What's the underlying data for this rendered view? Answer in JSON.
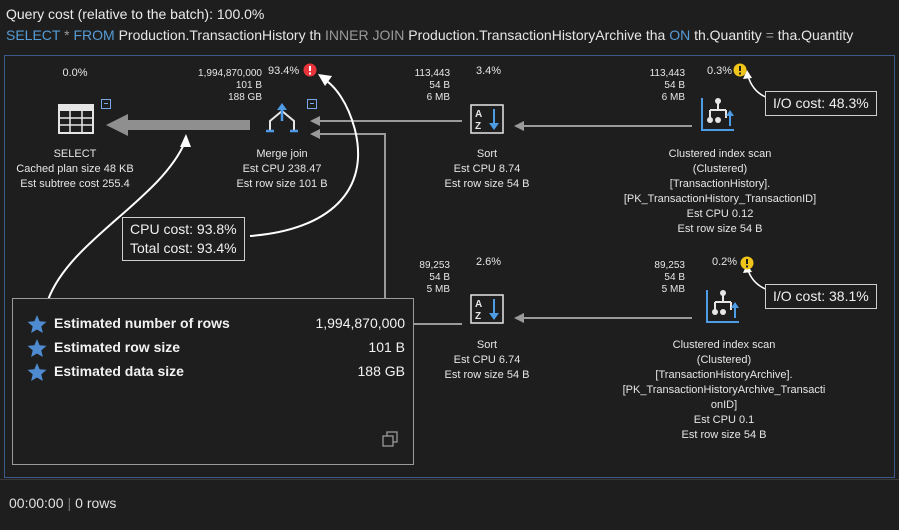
{
  "header": {
    "query_cost": "Query cost (relative to the batch):  100.0%",
    "sql": {
      "select": "SELECT",
      "star": "*",
      "from": "FROM",
      "table1": "Production.TransactionHistory th",
      "join": "INNER JOIN",
      "table2": "Production.TransactionHistoryArchive tha",
      "on": "ON",
      "left_col": "th.Quantity",
      "eq": "=",
      "right_col": "tha.Quantity"
    }
  },
  "nodes": {
    "select": {
      "cost": "0.0%",
      "name": "SELECT",
      "line1": "Cached plan size  48 KB",
      "line2": "Est subtree cost  255.4",
      "icon": "select-grid-icon"
    },
    "merge_join": {
      "rows": "1,994,870,000",
      "row_size": "101 B",
      "data_size": "188 GB",
      "cost": "93.4%",
      "name": "Merge join",
      "line1": "Est CPU  238.47",
      "line2": "Est row size  101 B",
      "icon": "merge-join-icon",
      "warning_icon": "error-icon"
    },
    "sort_top": {
      "rows": "113,443",
      "row_size": "54 B",
      "data_size": "6 MB",
      "cost": "3.4%",
      "name": "Sort",
      "line1": "Est CPU  8.74",
      "line2": "Est row size  54 B",
      "icon": "sort-az-icon"
    },
    "scan_top": {
      "rows": "113,443",
      "row_size": "54 B",
      "data_size": "6 MB",
      "cost": "0.3%",
      "name": "Clustered index scan",
      "line1": "(Clustered)",
      "line2": "[TransactionHistory].",
      "line3": "[PK_TransactionHistory_TransactionID]",
      "line4": "Est CPU  0.12",
      "line5": "Est row size  54 B",
      "icon": "clustered-index-scan-icon",
      "warning_icon": "warning-icon"
    },
    "sort_bottom": {
      "rows": "89,253",
      "row_size": "54 B",
      "data_size": "5 MB",
      "cost": "2.6%",
      "name": "Sort",
      "line1": "Est CPU  6.74",
      "line2": "Est row size  54 B",
      "icon": "sort-az-icon"
    },
    "scan_bottom": {
      "rows": "89,253",
      "row_size": "54 B",
      "data_size": "5 MB",
      "cost": "0.2%",
      "name": "Clustered index scan",
      "line1": "(Clustered)",
      "line2": "[TransactionHistoryArchive].",
      "line3": "[PK_TransactionHistoryArchive_Transacti",
      "line4": "onID]",
      "line5": "Est CPU  0.1",
      "line6": "Est row size  54 B",
      "icon": "clustered-index-scan-icon",
      "warning_icon": "warning-icon"
    }
  },
  "callouts": {
    "cpu": "CPU cost: 93.8%",
    "total": "Total cost: 93.4%",
    "io_top": "I/O cost: 48.3%",
    "io_bottom": "I/O cost: 38.1%"
  },
  "tooltip": {
    "rows": [
      {
        "label": "Estimated number of rows",
        "value": "1,994,870,000"
      },
      {
        "label": "Estimated row size",
        "value": "101 B"
      },
      {
        "label": "Estimated data size",
        "value": "188 GB"
      }
    ],
    "star_icon": "star-icon",
    "copy_icon": "copy-icon"
  },
  "footer": {
    "time": "00:00:00",
    "rows": "0 rows"
  },
  "colors": {
    "background": "#1e1e1e",
    "keyword": "#569cd6",
    "icon_blue": "#4e9be6",
    "error": "#e8343a",
    "warning": "#f0c419",
    "panel_border": "#3c5a8a",
    "arrow": "#9a9a9a"
  }
}
